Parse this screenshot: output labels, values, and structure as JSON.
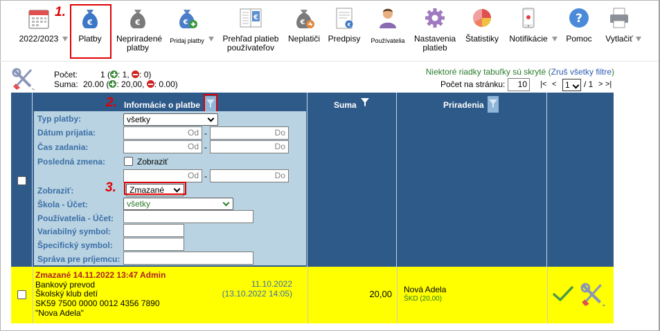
{
  "toolbar": {
    "items": [
      {
        "label": "2022/2023",
        "icon": "calendar-icon"
      },
      {
        "label": "Platby",
        "icon": "money-bag-euro-icon"
      },
      {
        "label": "Nepriradené platby",
        "icon": "money-bag-unassigned-icon"
      },
      {
        "label": "Pridaj platby",
        "icon": "money-bag-add-icon"
      },
      {
        "label": "Prehľad platieb používateľov",
        "icon": "payment-overview-icon"
      },
      {
        "label": "Neplatiči",
        "icon": "money-bag-debtors-icon"
      },
      {
        "label": "Predpisy",
        "icon": "prescription-document-icon"
      },
      {
        "label": "Používatelia",
        "icon": "user-icon"
      },
      {
        "label": "Nastavenia platieb",
        "icon": "gear-icon"
      },
      {
        "label": "Štatistiky",
        "icon": "pie-chart-icon"
      },
      {
        "label": "Notifikácie",
        "icon": "phone-notification-icon"
      },
      {
        "label": "Pomoc",
        "icon": "help-icon"
      },
      {
        "label": "Vytlačiť",
        "icon": "printer-icon"
      }
    ]
  },
  "steps": {
    "s1": "1.",
    "s2": "2.",
    "s3": "3."
  },
  "summary": {
    "count_label": "Počet:",
    "count_value": "1 (",
    "count_plus": ": 1, ",
    "count_minus": ": 0)",
    "sum_label": "Suma:",
    "sum_value": "20.00 (",
    "sum_plus": ": 20,00, ",
    "sum_minus": ": 0.00)"
  },
  "hidden_rows": {
    "text": "Niektoré riadky tabuľky sú skryté (",
    "link": "Zruš všetky filtre",
    "close": ")"
  },
  "paging": {
    "per_page_label": "Počet na stránku:",
    "per_page_value": "10",
    "first": "|<",
    "prev": "<",
    "page": "1",
    "of": "/ 1",
    "next": ">",
    "last": ">|"
  },
  "grid": {
    "col_info": "Informácie o platbe",
    "col_sum": "Suma",
    "col_assign": "Priradenia"
  },
  "filters": {
    "typ_platby_label": "Typ platby:",
    "typ_platby_value": "všetky",
    "datum_prijatia_label": "Dátum prijatia:",
    "cas_zadania_label": "Čas zadania:",
    "posledna_zmena_label": "Posledná zmena:",
    "zobrazit_check_label": "Zobraziť",
    "od_placeholder": "Od",
    "do_placeholder": "Do",
    "zobrazit_label": "Zobraziť:",
    "zobrazit_value": "Zmazané",
    "skola_ucet_label": "Škola - Účet:",
    "skola_ucet_value": "všetky",
    "pouzivatelia_ucet_label": "Používatelia - Účet:",
    "variabilny_symbol_label": "Variabilný symbol:",
    "specificky_symbol_label": "Špecifický symbol:",
    "sprava_label": "Správa pre príjemcu:"
  },
  "row": {
    "deleted": "Zmazané 14.11.2022 13:47 Admin",
    "type": "Bankový prevod",
    "club": "Školský klub detí",
    "iban": "SK59 7500 0000 0012 4356 7890",
    "name_quoted": "\"Nova Adela\"",
    "date": "11.10.2022",
    "date_entered": "(13.10.2022 14:05)",
    "amount": "20,00",
    "assigned_name": "Nová Adela",
    "assigned_detail": "ŠKD (20,00)"
  }
}
